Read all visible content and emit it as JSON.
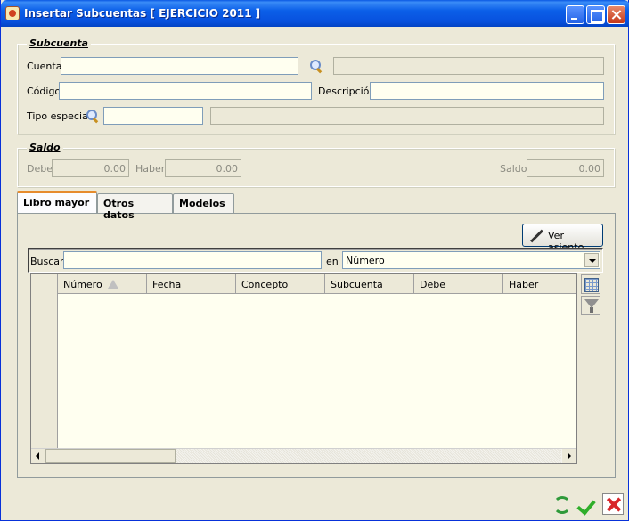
{
  "window": {
    "title": "Insertar Subcuentas [ EJERCICIO 2011 ]"
  },
  "subcuenta": {
    "legend": "Subcuenta",
    "cuenta_label": "Cuenta",
    "cuenta_value": "",
    "cuenta_desc": "",
    "codigo_label": "Código",
    "codigo_value": "",
    "descripcion_label": "Descripción",
    "descripcion_value": "",
    "tipo_label": "Tipo especial",
    "tipo_value": "",
    "tipo_desc": ""
  },
  "saldo": {
    "legend": "Saldo",
    "debe_label": "Debe",
    "debe_value": "0.00",
    "haber_label": "Haber",
    "haber_value": "0.00",
    "saldo_label": "Saldo",
    "saldo_value": "0.00"
  },
  "tabs": [
    {
      "label": "Libro mayor",
      "active": true
    },
    {
      "label": "Otros datos",
      "active": false
    },
    {
      "label": "Modelos",
      "active": false
    }
  ],
  "libro": {
    "ver_asiento": "Ver asiento",
    "buscar_label": "Buscar",
    "buscar_value": "",
    "en_label": "en",
    "en_selected": "Número",
    "columns": [
      "Número",
      "Fecha",
      "Concepto",
      "Subcuenta",
      "Debe",
      "Haber"
    ],
    "rows": []
  },
  "colors": {
    "title_bar": "#0b5fe8",
    "field_bg": "#fffff0",
    "window_bg": "#ece9d8"
  }
}
